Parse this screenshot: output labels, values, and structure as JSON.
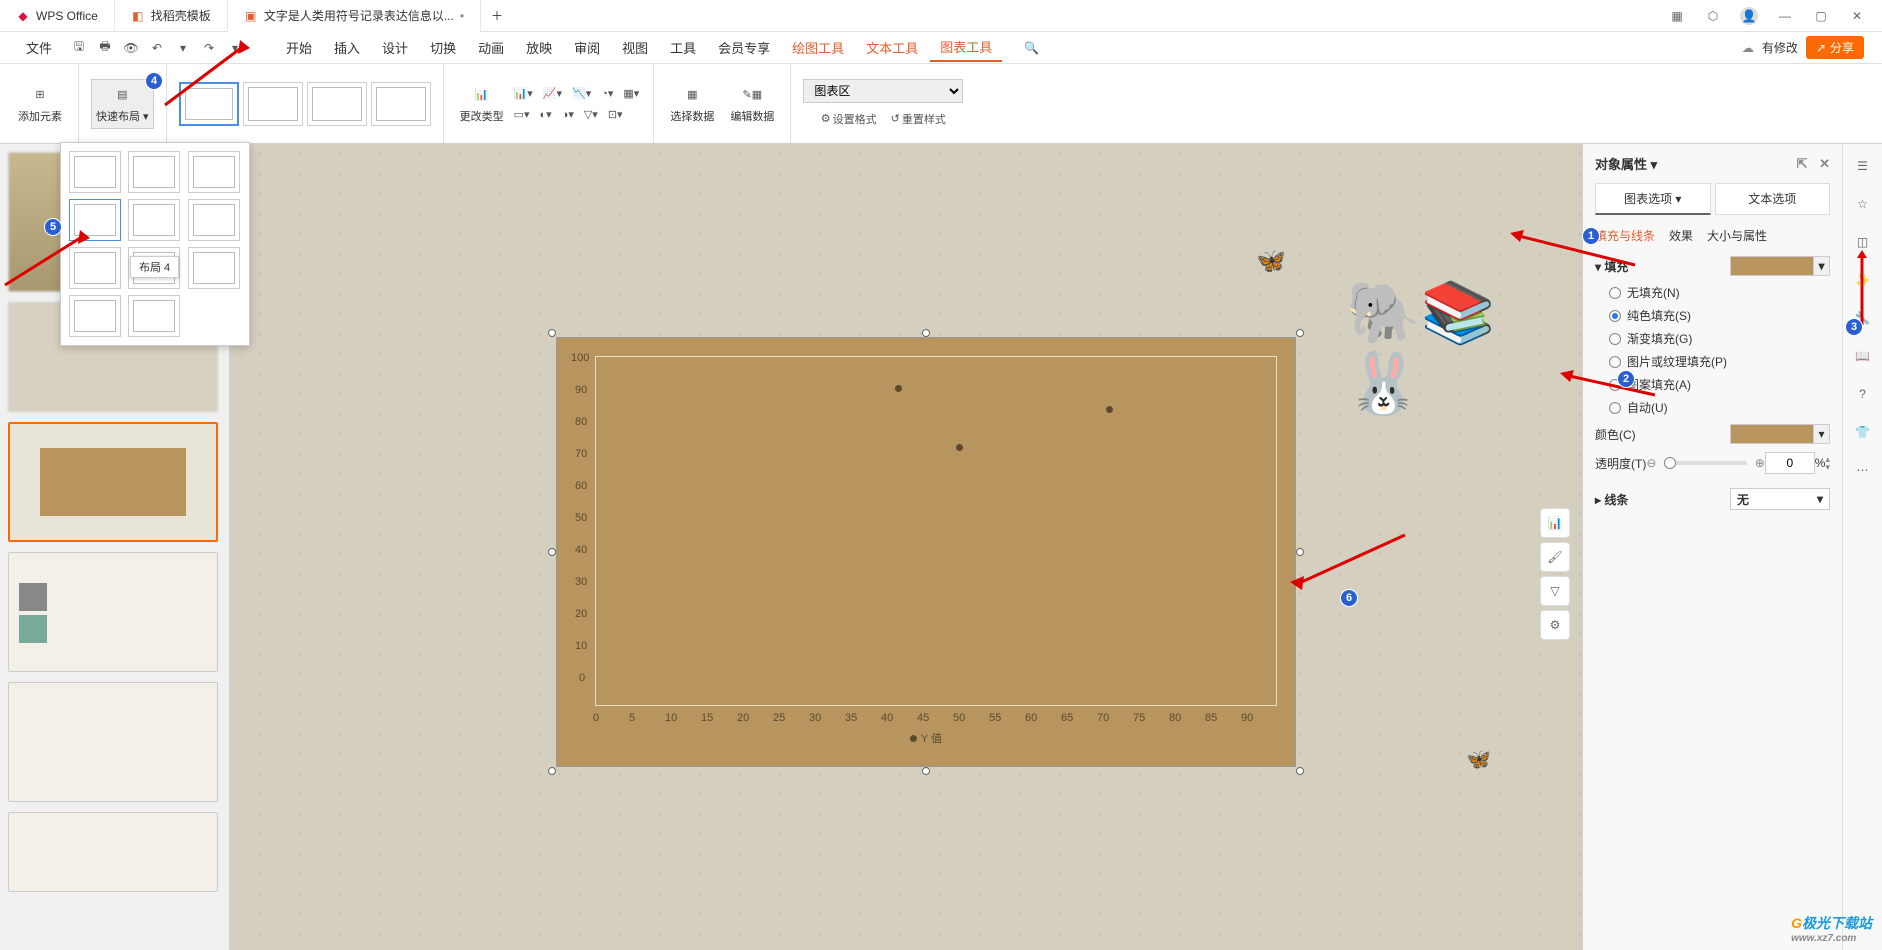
{
  "titlebar": {
    "tabs": [
      {
        "label": "WPS Office",
        "icon": "wps"
      },
      {
        "label": "找稻壳模板",
        "icon": "template"
      },
      {
        "label": "文字是人类用符号记录表达信息以...",
        "icon": "ppt",
        "modified": true
      }
    ]
  },
  "qat": {
    "file_label": "文件"
  },
  "menubar": {
    "items": [
      "开始",
      "插入",
      "设计",
      "切换",
      "动画",
      "放映",
      "审阅",
      "视图",
      "工具",
      "会员专享",
      "绘图工具",
      "文本工具",
      "图表工具"
    ],
    "active_index": 12,
    "right": {
      "modified": "有修改",
      "share": "分享"
    }
  },
  "ribbon": {
    "add_element": "添加元素",
    "quick_layout": "快速布局",
    "change_type": "更改类型",
    "select_data": "选择数据",
    "edit_data": "编辑数据",
    "chart_area_selector": "图表区",
    "set_format": "设置格式",
    "reset_style": "重置样式"
  },
  "layout_popup": {
    "tooltip": "布局 4"
  },
  "chart_data": {
    "type": "scatter",
    "title": "",
    "xlabel": "",
    "ylabel": "",
    "xlim": [
      0,
      90
    ],
    "ylim": [
      0,
      100
    ],
    "x_ticks": [
      0,
      5,
      10,
      15,
      20,
      25,
      30,
      35,
      40,
      45,
      50,
      55,
      60,
      65,
      70,
      75,
      80,
      85,
      90
    ],
    "y_ticks": [
      0,
      10,
      20,
      30,
      40,
      50,
      60,
      70,
      80,
      90,
      100
    ],
    "series": [
      {
        "name": "Y 值",
        "points": [
          {
            "x": 40,
            "y": 92
          },
          {
            "x": 48,
            "y": 75
          },
          {
            "x": 68,
            "y": 86
          }
        ]
      }
    ],
    "legend": "Y 值"
  },
  "props": {
    "title": "对象属性",
    "tab_chart": "图表选项",
    "tab_text": "文本选项",
    "subtab_fill": "填充与线条",
    "subtab_effect": "效果",
    "subtab_size": "大小与属性",
    "section_fill": "填充",
    "fill_options": {
      "none": "无填充(N)",
      "solid": "纯色填充(S)",
      "gradient": "渐变填充(G)",
      "picture": "图片或纹理填充(P)",
      "pattern": "图案填充(A)",
      "auto": "自动(U)"
    },
    "fill_selected": "solid",
    "color_label": "颜色(C)",
    "fill_color": "#b8955f",
    "transparency_label": "透明度(T)",
    "transparency_value": "0",
    "transparency_unit": "%",
    "section_line": "线条",
    "line_value": "无"
  },
  "watermark": {
    "brand": "极光下载站",
    "url": "www.xz7.com"
  }
}
